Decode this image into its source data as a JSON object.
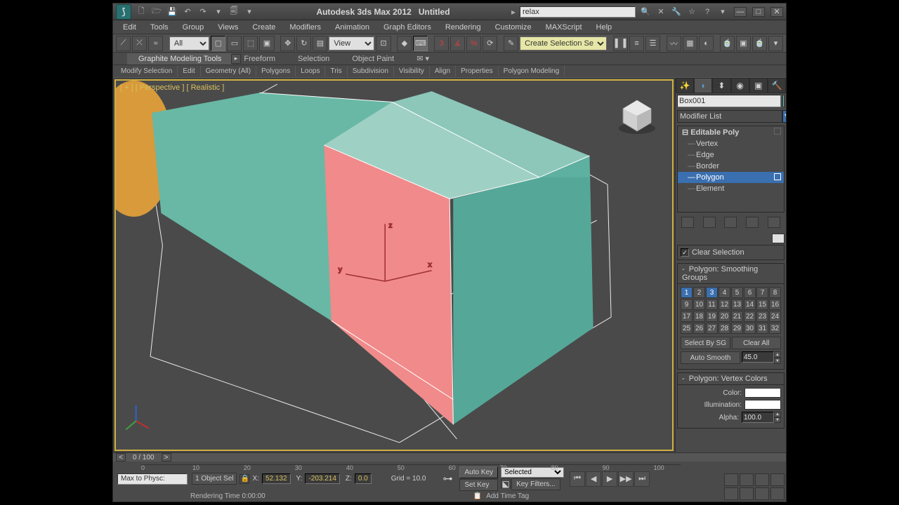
{
  "titlebar": {
    "app_title": "Autodesk 3ds Max  2012",
    "doc_title": "Untitled",
    "search_value": "relax"
  },
  "menubar": [
    "Edit",
    "Tools",
    "Group",
    "Views",
    "Create",
    "Modifiers",
    "Animation",
    "Graph Editors",
    "Rendering",
    "Customize",
    "MAXScript",
    "Help"
  ],
  "toolbar": {
    "filter_label": "All",
    "view_label": "View",
    "named_sel": "Create Selection Se"
  },
  "ribbon": {
    "tabs": [
      "Graphite Modeling Tools",
      "Freeform",
      "Selection",
      "Object Paint"
    ],
    "subs": [
      "Modify Selection",
      "Edit",
      "Geometry (All)",
      "Polygons",
      "Loops",
      "Tris",
      "Subdivision",
      "Visibility",
      "Align",
      "Properties",
      "Polygon Modeling"
    ]
  },
  "viewport": {
    "label_bracket": "[ + ]",
    "label_persp": "[ Perspective ]",
    "label_shade": "[ Realistic ]"
  },
  "panel": {
    "object_name": "Box001",
    "modifier_list": "Modifier List",
    "stack_parent": "Editable Poly",
    "stack_items": [
      "Vertex",
      "Edge",
      "Border",
      "Polygon",
      "Element"
    ],
    "stack_selected": "Polygon",
    "clear_selection": "Clear Selection",
    "rollout_sg": "Polygon: Smoothing Groups",
    "sg_on": [
      1,
      3
    ],
    "select_by_sg": "Select By SG",
    "clear_all": "Clear All",
    "auto_smooth": "Auto Smooth",
    "auto_smooth_val": "45.0",
    "rollout_vc": "Polygon: Vertex Colors",
    "vc_color": "Color:",
    "vc_illum": "Illumination:",
    "vc_alpha": "Alpha:",
    "vc_alpha_val": "100.0"
  },
  "bottom": {
    "time_pos": "0 / 100",
    "ticks": [
      "0",
      "10",
      "20",
      "30",
      "40",
      "50",
      "60",
      "70",
      "80",
      "90",
      "100"
    ],
    "selcount": "1 Object Sel",
    "x_label": "X:",
    "x_val": "52.132",
    "y_label": "Y:",
    "y_val": "-203.214",
    "z_label": "Z:",
    "z_val": "0.0",
    "grid": "Grid = 10.0",
    "autokey": "Auto Key",
    "setkey": "Set Key",
    "selected": "Selected",
    "keyfilters": "Key Filters...",
    "addtag": "Add Time Tag",
    "prompt": "Max to Physc:",
    "render_time": "Rendering Time  0:00:00"
  }
}
